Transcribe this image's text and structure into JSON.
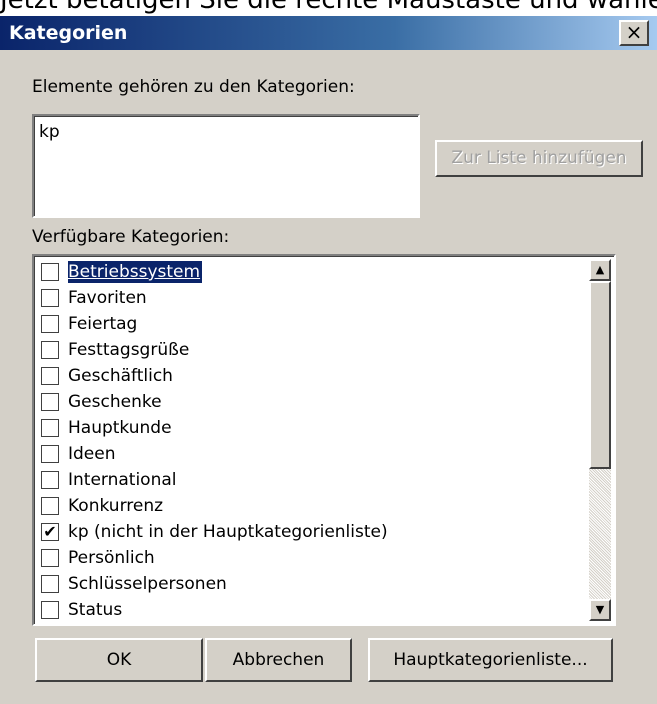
{
  "background_text": "Jetzt betätigen Sie die rechte Maustaste und wählen",
  "dialog": {
    "title": "Kategorien",
    "close_label": "×"
  },
  "assigned": {
    "label": "Elemente gehören zu den Kategorien:",
    "value": "kp",
    "add_button": "Zur Liste hinzufügen"
  },
  "available": {
    "label": "Verfügbare Kategorien:",
    "items": [
      {
        "label": "Betriebssystem",
        "checked": false,
        "selected": true
      },
      {
        "label": "Favoriten",
        "checked": false
      },
      {
        "label": "Feiertag",
        "checked": false
      },
      {
        "label": "Festtagsgrüße",
        "checked": false
      },
      {
        "label": "Geschäftlich",
        "checked": false
      },
      {
        "label": "Geschenke",
        "checked": false
      },
      {
        "label": "Hauptkunde",
        "checked": false
      },
      {
        "label": "Ideen",
        "checked": false
      },
      {
        "label": "International",
        "checked": false
      },
      {
        "label": "Konkurrenz",
        "checked": false
      },
      {
        "label": "kp (nicht in der Hauptkategorienliste)",
        "checked": true
      },
      {
        "label": "Persönlich",
        "checked": false
      },
      {
        "label": "Schlüsselpersonen",
        "checked": false
      },
      {
        "label": "Status",
        "checked": false
      }
    ]
  },
  "buttons": {
    "ok": "OK",
    "cancel": "Abbrechen",
    "master_list": "Hauptkategorienliste..."
  }
}
